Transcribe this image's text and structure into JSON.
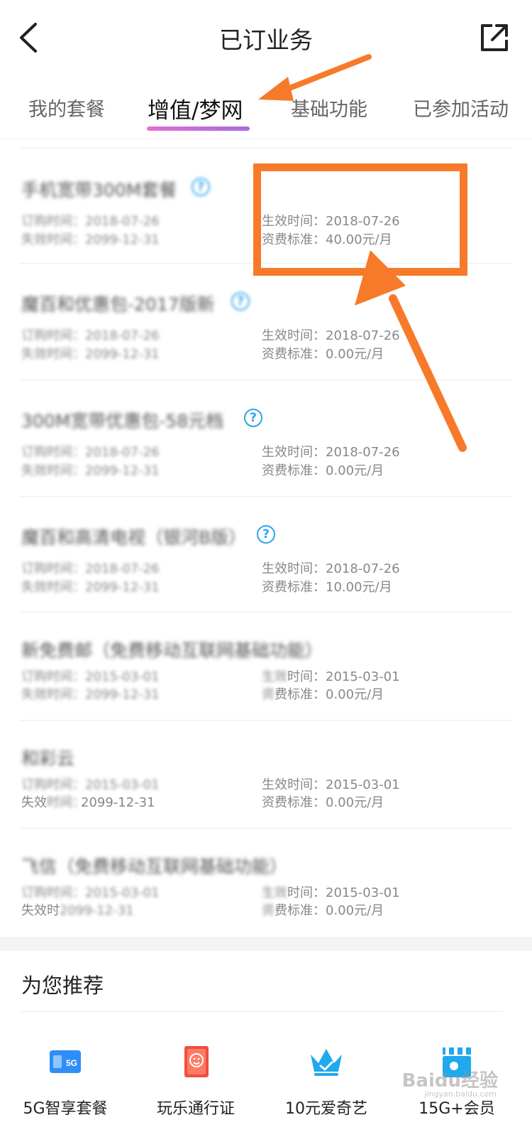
{
  "header": {
    "title": "已订业务"
  },
  "tabs": [
    {
      "label": "我的套餐"
    },
    {
      "label": "增值/梦网"
    },
    {
      "label": "基础功能"
    },
    {
      "label": "已参加活动"
    }
  ],
  "items": [
    {
      "name": "手机宽带300M套餐",
      "order_date": "订购时间：2018-07-26",
      "expire_date": "失效时间：2099-12-31",
      "effective_date": "生效时间：2018-07-26",
      "fee": "资费标准：40.00元/月"
    },
    {
      "name": "魔百和优惠包-2017版新",
      "order_date": "订购时间：2018-07-26",
      "expire_date": "失效时间：2099-12-31",
      "effective_date": "生效时间：2018-07-26",
      "fee": "资费标准：0.00元/月"
    },
    {
      "name": "300M宽带优惠包-58元档",
      "order_date": "订购时间：2018-07-26",
      "expire_date": "失效时间：2099-12-31",
      "effective_date": "生效时间：2018-07-26",
      "fee": "资费标准：0.00元/月"
    },
    {
      "name": "魔百和高清电视（银河B版）",
      "order_date": "订购时间：2018-07-26",
      "expire_date": "失效时间：2099-12-31",
      "effective_date": "生效时间：2018-07-26",
      "fee": "资费标准：10.00元/月"
    },
    {
      "name": "新免费邮（免费移动互联网基础功能）",
      "order_date": "订购时间：2015-03-01",
      "expire_date": "失效时间：2099-12-31",
      "effective_prefix": "生效",
      "effective_value": "时间：2015-03-01",
      "fee_prefix": "资",
      "fee_value": "费标准：0.00元/月"
    },
    {
      "name": "和彩云",
      "order_date": "订购时间：2015-03-01",
      "expire_label": "失效",
      "expire_value": "2099-12-31",
      "effective_date": "生效时间：2015-03-01",
      "fee": "资费标准：0.00元/月"
    },
    {
      "name": "飞信（免费移动互联网基础功能）",
      "order_date": "订购时间：2015-03-01",
      "expire_label": "失效时",
      "expire_value": "2099-12-31",
      "effective_prefix": "生效",
      "effective_value": "时间：2015-03-01",
      "fee_prefix": "资",
      "fee_value": "费标准：0.00元/月"
    }
  ],
  "help_icon_glyph": "?",
  "recommend": {
    "title": "为您推荐",
    "items": [
      {
        "label": "5G智享套餐",
        "icon": "5g-card-icon",
        "badge": "5G"
      },
      {
        "label": "玩乐通行证",
        "icon": "smiley-passport-icon"
      },
      {
        "label": "10元爱奇艺",
        "icon": "crown-icon"
      },
      {
        "label": "15G+会员",
        "icon": "film-clapper-icon"
      }
    ]
  },
  "watermark": {
    "brand": "Baidu经验",
    "sub": "jingyan.baidu.com"
  },
  "colors": {
    "accent_orange": "#f77a2a",
    "help_blue": "#2ea6ee",
    "tab_gradient_start": "#e26fd0",
    "tab_gradient_end": "#a66be4"
  }
}
